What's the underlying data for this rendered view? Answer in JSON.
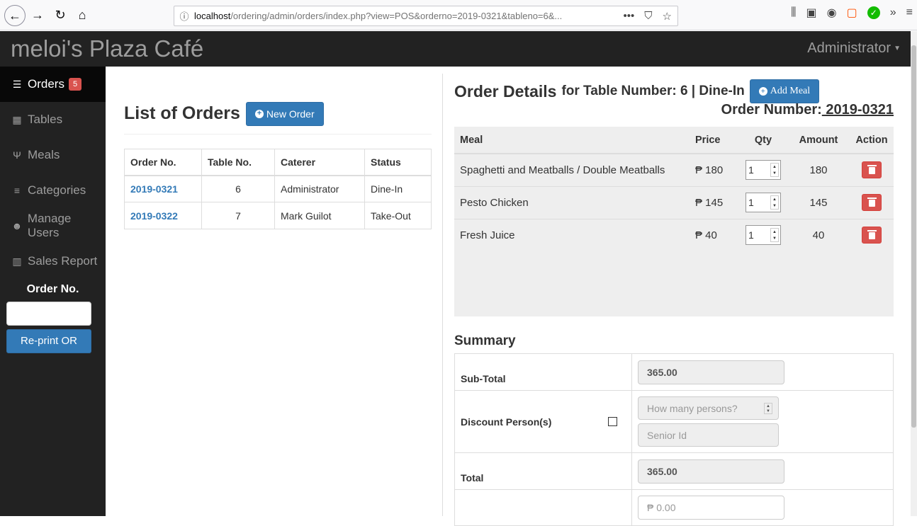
{
  "browser": {
    "url_host": "localhost",
    "url_path": "/ordering/admin/orders/index.php?view=POS&orderno=2019-0321&tableno=6&..."
  },
  "header": {
    "brand": "meloi's Plaza Café",
    "user": "Administrator"
  },
  "sidebar": {
    "items": [
      {
        "label": "Orders",
        "icon": "list-icon",
        "badge": "5",
        "active": true
      },
      {
        "label": "Tables",
        "icon": "table-icon"
      },
      {
        "label": "Meals",
        "icon": "cutlery-icon"
      },
      {
        "label": "Categories",
        "icon": "align-justify-icon"
      },
      {
        "label": "Manage Users",
        "icon": "users-icon"
      },
      {
        "label": "Sales Report",
        "icon": "bar-chart-icon"
      }
    ],
    "order_no_label": "Order No.",
    "reprint_label": "Re-print OR"
  },
  "orders_list": {
    "title": "List of Orders",
    "new_order_label": "New Order",
    "columns": [
      "Order No.",
      "Table No.",
      "Caterer",
      "Status"
    ],
    "rows": [
      {
        "order_no": "2019-0321",
        "table_no": "6",
        "caterer": "Administrator",
        "status": "Dine-In"
      },
      {
        "order_no": "2019-0322",
        "table_no": "7",
        "caterer": "Mark Guilot",
        "status": "Take-Out"
      }
    ]
  },
  "order_details": {
    "title": "Order Details",
    "subtitle": "for Table Number: 6 | Dine-In",
    "add_meal_label": "Add Meal",
    "order_number_label": "Order Number:",
    "order_number": " 2019-0321",
    "columns": {
      "meal": "Meal",
      "price": "Price",
      "qty": "Qty",
      "amount": "Amount",
      "action": "Action"
    },
    "items": [
      {
        "meal": "Spaghetti and Meatballs / Double Meatballs",
        "price": "₱ 180",
        "qty": "1",
        "amount": "180"
      },
      {
        "meal": "Pesto Chicken",
        "price": "₱ 145",
        "qty": "1",
        "amount": "145"
      },
      {
        "meal": "Fresh Juice",
        "price": "₱ 40",
        "qty": "1",
        "amount": "40"
      }
    ]
  },
  "summary": {
    "title": "Summary",
    "subtotal_label": "Sub-Total",
    "subtotal": "365.00",
    "discount_label": "Discount Person(s)",
    "persons_placeholder": "How many persons?",
    "senior_placeholder": "Senior Id",
    "total_label": "Total",
    "total": "365.00",
    "tendered_placeholder": "₱ 0.00"
  },
  "colors": {
    "primary": "#337ab7",
    "danger": "#d9534f",
    "navbar": "#222222"
  }
}
